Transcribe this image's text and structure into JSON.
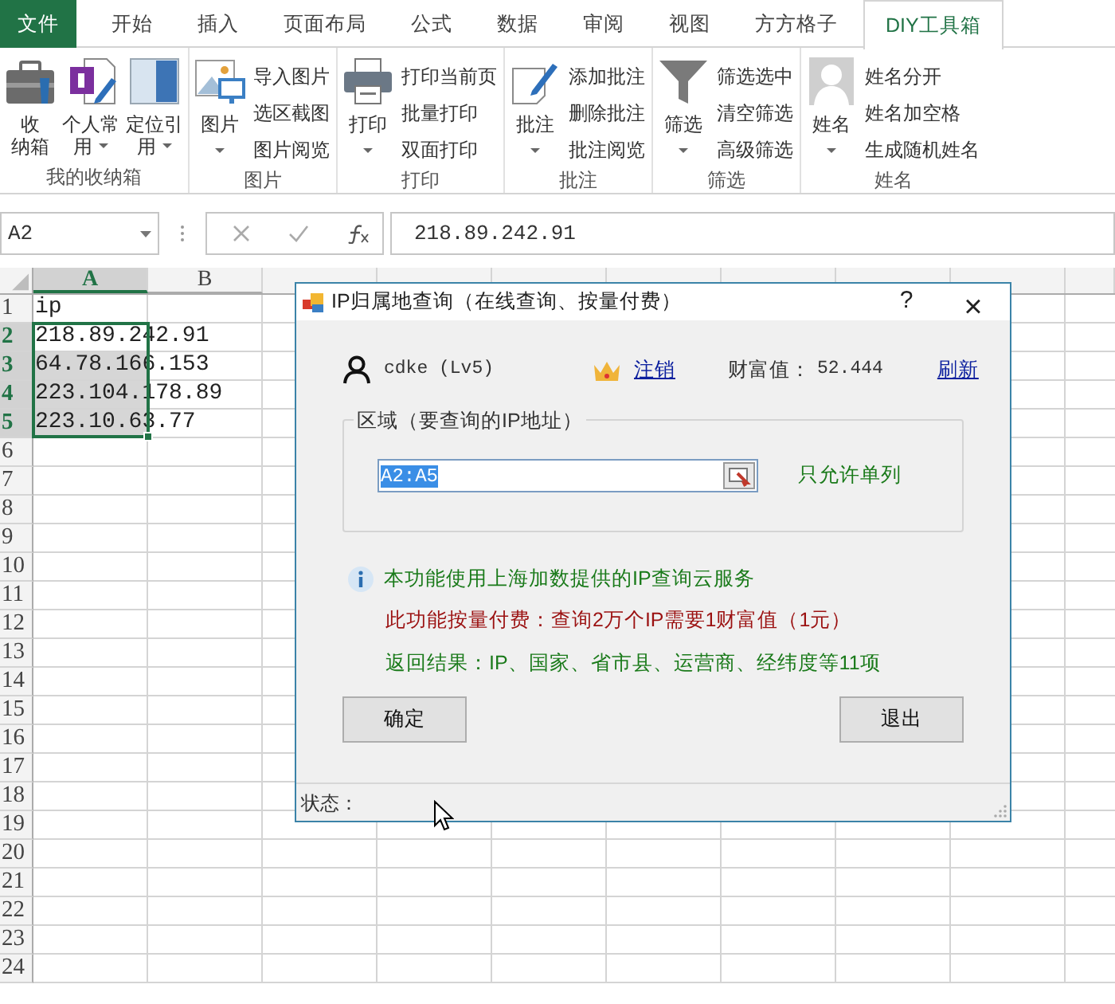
{
  "ribbon": {
    "tabs": [
      {
        "label": "文件",
        "kind": "file",
        "selected": false
      },
      {
        "label": "开始",
        "kind": "tab",
        "selected": false
      },
      {
        "label": "插入",
        "kind": "tab",
        "selected": false
      },
      {
        "label": "页面布局",
        "kind": "tab",
        "selected": false
      },
      {
        "label": "公式",
        "kind": "tab",
        "selected": false
      },
      {
        "label": "数据",
        "kind": "tab",
        "selected": false
      },
      {
        "label": "审阅",
        "kind": "tab",
        "selected": false
      },
      {
        "label": "视图",
        "kind": "tab",
        "selected": false
      },
      {
        "label": "方方格子",
        "kind": "tab",
        "selected": false
      },
      {
        "label": "DIY工具箱",
        "kind": "tab",
        "selected": true
      }
    ],
    "groups": [
      {
        "label": "我的收纳箱",
        "items": [
          {
            "kind": "large",
            "lines": [
              "收",
              "纳箱"
            ],
            "dropdown": false
          },
          {
            "kind": "large",
            "lines": [
              "个人常",
              "用"
            ],
            "dropdown": true
          },
          {
            "kind": "large",
            "lines": [
              "定位引",
              "用"
            ],
            "dropdown": true
          }
        ]
      },
      {
        "label": "图片",
        "items": [
          {
            "kind": "large",
            "lines": [
              "图片"
            ],
            "dropdown": true
          },
          {
            "kind": "small",
            "label": "导入图片"
          },
          {
            "kind": "small",
            "label": "选区截图"
          },
          {
            "kind": "small",
            "label": "图片阅览"
          }
        ]
      },
      {
        "label": "打印",
        "items": [
          {
            "kind": "large",
            "lines": [
              "打印"
            ],
            "dropdown": true
          },
          {
            "kind": "small",
            "label": "打印当前页"
          },
          {
            "kind": "small",
            "label": "批量打印"
          },
          {
            "kind": "small",
            "label": "双面打印"
          }
        ]
      },
      {
        "label": "批注",
        "items": [
          {
            "kind": "large",
            "lines": [
              "批注"
            ],
            "dropdown": true
          },
          {
            "kind": "small",
            "label": "添加批注"
          },
          {
            "kind": "small",
            "label": "删除批注"
          },
          {
            "kind": "small",
            "label": "批注阅览"
          }
        ]
      },
      {
        "label": "筛选",
        "items": [
          {
            "kind": "large",
            "lines": [
              "筛选"
            ],
            "dropdown": true
          },
          {
            "kind": "small",
            "label": "筛选选中"
          },
          {
            "kind": "small",
            "label": "清空筛选"
          },
          {
            "kind": "small",
            "label": "高级筛选"
          }
        ]
      },
      {
        "label": "姓名",
        "items": [
          {
            "kind": "large",
            "lines": [
              "姓名"
            ],
            "dropdown": true
          },
          {
            "kind": "small",
            "label": "姓名分开"
          },
          {
            "kind": "small",
            "label": "姓名加空格"
          },
          {
            "kind": "small",
            "label": "生成随机姓名"
          }
        ]
      }
    ]
  },
  "formula_bar": {
    "name_box": "A2",
    "formula": "218.89.242.91"
  },
  "sheet": {
    "columns": [
      {
        "label": "A",
        "selected": true
      },
      {
        "label": "B",
        "selected": false
      }
    ],
    "rows": [
      {
        "label": "1",
        "selected": false,
        "value": "ip"
      },
      {
        "label": "2",
        "selected": true,
        "value": "218.89.242.91"
      },
      {
        "label": "3",
        "selected": true,
        "value": "64.78.166.153"
      },
      {
        "label": "4",
        "selected": true,
        "value": "223.104.178.89"
      },
      {
        "label": "5",
        "selected": true,
        "value": "223.10.63.77"
      },
      {
        "label": "6",
        "selected": false
      },
      {
        "label": "7",
        "selected": false
      },
      {
        "label": "8",
        "selected": false
      },
      {
        "label": "9",
        "selected": false
      },
      {
        "label": "10",
        "selected": false
      },
      {
        "label": "11",
        "selected": false
      },
      {
        "label": "12",
        "selected": false
      },
      {
        "label": "13",
        "selected": false
      },
      {
        "label": "14",
        "selected": false
      },
      {
        "label": "15",
        "selected": false
      },
      {
        "label": "16",
        "selected": false
      },
      {
        "label": "17",
        "selected": false
      },
      {
        "label": "18",
        "selected": false
      },
      {
        "label": "19",
        "selected": false
      },
      {
        "label": "20",
        "selected": false
      },
      {
        "label": "21",
        "selected": false
      },
      {
        "label": "22",
        "selected": false
      },
      {
        "label": "23",
        "selected": false
      },
      {
        "label": "24",
        "selected": false
      }
    ]
  },
  "dialog": {
    "title": "IP归属地查询（在线查询、按量付费）",
    "help": "?",
    "close": "×",
    "user": "cdke (Lv5)",
    "logout": "注销",
    "wealth_label": "财富值：",
    "wealth": "52.444",
    "refresh": "刷新",
    "group": {
      "legend": "区域（要查询的IP地址）",
      "range": "A2:A5",
      "range_selected": true,
      "hint": "只允许单列"
    },
    "notes": [
      {
        "kind": "info",
        "text": "本功能使用上海加数提供的IP查询云服务",
        "color": "#1a7a1a"
      },
      {
        "kind": "plain",
        "text": "此功能按量付费：查询2万个IP需要1财富值（1元）",
        "color": "#9b1111"
      },
      {
        "kind": "plain",
        "text": "返回结果：IP、国家、省市县、运营商、经纬度等11项",
        "color": "#1a7a1a"
      }
    ],
    "buttons": [
      "确定",
      "退出"
    ],
    "status": "状态："
  }
}
